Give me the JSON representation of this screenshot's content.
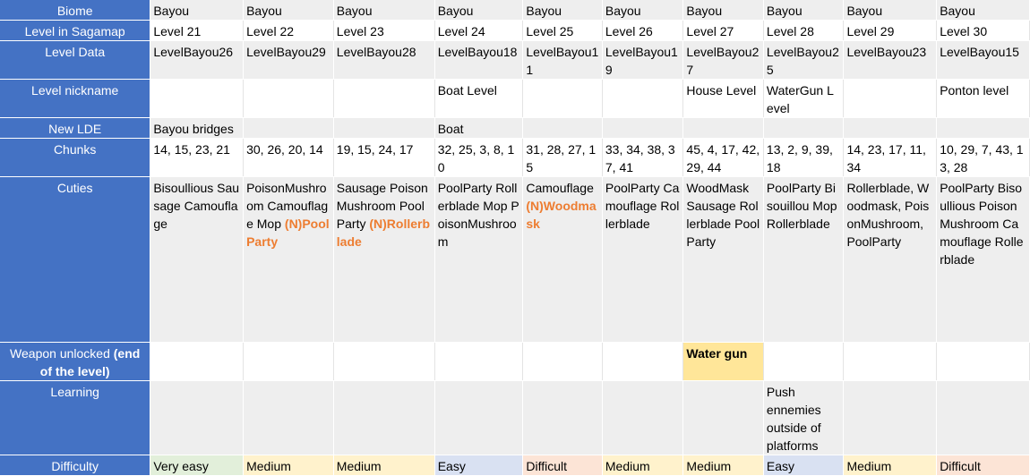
{
  "headers": {
    "biome": "Biome",
    "level": "Level in Sagamap",
    "level_data": "Level Data",
    "nickname": "Level nickname",
    "new_lde": "New LDE",
    "chunks": "Chunks",
    "cuties": "Cuties",
    "weapon_a": "Weapon unlocked ",
    "weapon_b": "(end of the level)",
    "learning": "Learning",
    "difficulty": "Difficulty"
  },
  "columns": [
    {
      "biome": "Bayou",
      "level": "Level 21",
      "data": "LevelBayou26",
      "nickname": "",
      "lde": "Bayou bridges",
      "chunks": "14, 15, 23, 21",
      "cuties": "Bisoullious Sausage Camouflage",
      "new": "",
      "weapon": "",
      "learning": "",
      "difficulty": "Very easy"
    },
    {
      "biome": "Bayou",
      "level": "Level 22",
      "data": "LevelBayou29",
      "nickname": "",
      "lde": "",
      "chunks": "30, 26, 20, 14",
      "cuties": "PoisonMushroom Camouflage Mop",
      "new": "(N)PoolParty",
      "weapon": "",
      "learning": "",
      "difficulty": "Medium"
    },
    {
      "biome": "Bayou",
      "level": "Level 23",
      "data": "LevelBayou28",
      "nickname": "",
      "lde": "",
      "chunks": "19, 15, 24, 17",
      "cuties": "Sausage PoisonMushroom PoolParty",
      "new": "(N)Rollerblade",
      "weapon": "",
      "learning": "",
      "difficulty": "Medium"
    },
    {
      "biome": "Bayou",
      "level": "Level 24",
      "data": "LevelBayou18",
      "nickname": "Boat Level",
      "lde": "Boat",
      "chunks": "32, 25, 3, 8, 10",
      "cuties": "PoolParty Rollerblade Mop PoisonMushroom",
      "new": "",
      "weapon": "",
      "learning": "",
      "difficulty": "Easy"
    },
    {
      "biome": "Bayou",
      "level": "Level 25",
      "data": "LevelBayou11",
      "nickname": "",
      "lde": "",
      "chunks": "31, 28, 27, 15",
      "cuties": "Camouflage",
      "new": "(N)Woodmask",
      "weapon": "",
      "learning": "",
      "difficulty": "Difficult"
    },
    {
      "biome": "Bayou",
      "level": "Level 26",
      "data": "LevelBayou19",
      "nickname": "",
      "lde": "",
      "chunks": "33, 34, 38, 37, 41",
      "cuties": "PoolParty Camouflage Rollerblade",
      "new": "",
      "weapon": "",
      "learning": "",
      "difficulty": "Medium"
    },
    {
      "biome": "Bayou",
      "level": "Level 27",
      "data": "LevelBayou27",
      "nickname": "House Level",
      "lde": "",
      "chunks": "45, 4, 17, 42, 29, 44",
      "cuties": "WoodMask Sausage Rollerblade PoolParty",
      "new": "",
      "weapon": "Water gun",
      "learning": "",
      "difficulty": "Medium"
    },
    {
      "biome": "Bayou",
      "level": "Level 28",
      "data": "LevelBayou25",
      "nickname": "WaterGun Level",
      "lde": "",
      "chunks": "13, 2, 9, 39, 18",
      "cuties": "PoolParty Bisouillou Mop Rollerblade",
      "new": "",
      "weapon": "",
      "learning": "Push ennemies outside of platforms",
      "difficulty": "Easy"
    },
    {
      "biome": "Bayou",
      "level": "Level 29",
      "data": "LevelBayou23",
      "nickname": "",
      "lde": "",
      "chunks": "14, 23, 17, 11, 34",
      "cuties": "Rollerblade, Woodmask, PoisonMushroom, PoolParty",
      "new": "",
      "weapon": "",
      "learning": "",
      "difficulty": "Medium"
    },
    {
      "biome": "Bayou",
      "level": "Level 30",
      "data": "LevelBayou15",
      "nickname": "Ponton level",
      "lde": "",
      "chunks": "10, 29, 7, 43, 13, 28",
      "cuties": "PoolParty Bisoullious PoisonMushroom Camouflage Rollerblade",
      "new": "",
      "weapon": "",
      "learning": "",
      "difficulty": "Difficult"
    }
  ],
  "colors": {
    "header_bg": "#4472c4",
    "new_cutie": "#ed7d31",
    "weapon_highlight": "#ffe699",
    "very_easy": "#e2efda",
    "easy": "#d9e1f2",
    "medium": "#fff2cc",
    "difficult": "#fce4d6"
  }
}
